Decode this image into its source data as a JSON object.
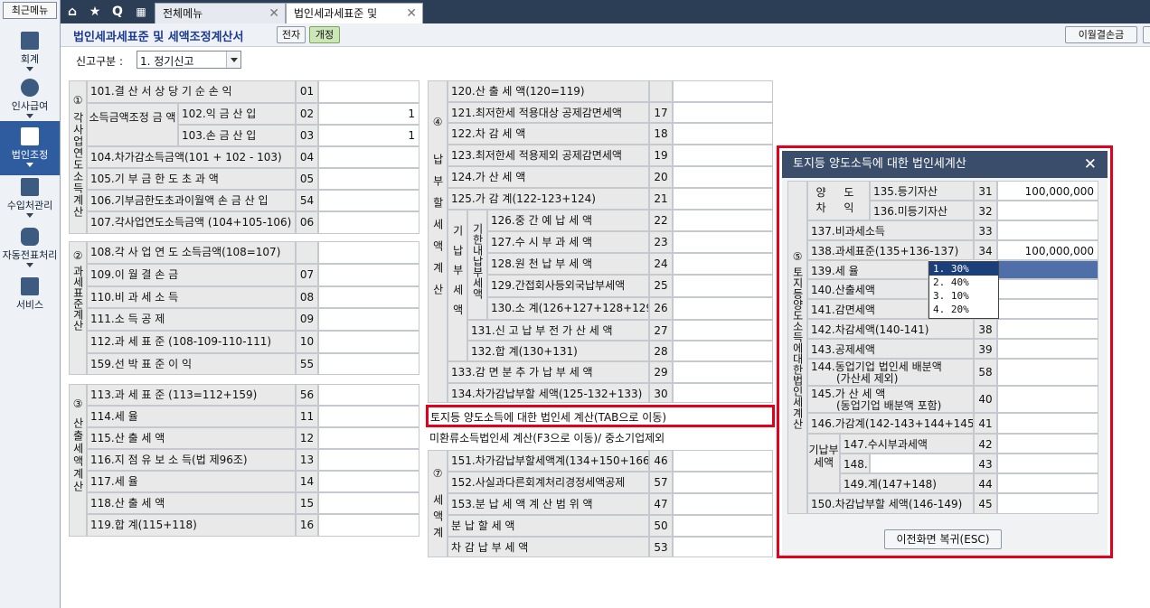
{
  "sidebar": {
    "recent": "최근메뉴",
    "items": [
      {
        "label": "회계",
        "icon": "calculator-icon"
      },
      {
        "label": "인사급여",
        "icon": "person-icon"
      },
      {
        "label": "법인조정",
        "icon": "building-icon"
      },
      {
        "label": "수입처관리",
        "icon": "people-icon"
      },
      {
        "label": "자동전표처리",
        "icon": "database-icon"
      },
      {
        "label": "서비스",
        "icon": "monitor-icon"
      }
    ]
  },
  "topbar": {
    "home": "⌂",
    "star": "★",
    "q": "Q",
    "tabs": [
      {
        "label": "전체메뉴"
      },
      {
        "label": "법인세과세표준 및"
      }
    ]
  },
  "titlebar": {
    "title": "법인세과세표준 및 세액조정계산서",
    "btn1": "전자",
    "btn2": "개정",
    "btn_right": "이월결손금"
  },
  "filter": {
    "label": "신고구분 :",
    "value": "1. 정기신고"
  },
  "s1": {
    "side": "① 각사업연도소득계산",
    "r101": "101.결 산 서 상 당 기 순 손 익",
    "n101": "01",
    "adj": "소득금액조정 금 액",
    "r102": "102.익 금 산 입",
    "n102": "02",
    "v102": "1",
    "r103": "103.손 금 산 입",
    "n103": "03",
    "v103": "1",
    "r104": "104.차가감소득금액(101 + 102 - 103)",
    "n104": "04",
    "r105": "105.기 부 금 한 도 초 과 액",
    "n105": "05",
    "r106": "106.기부금한도초과이월액 손 금 산 입",
    "n106": "54",
    "r107": "107.각사업연도소득금액 (104+105-106)",
    "n107": "06"
  },
  "s2": {
    "side": "② 과세표준계산",
    "r108": "108.각 사 업 연 도 소득금액(108=107)",
    "r109": "109.이 월 결 손 금",
    "n109": "07",
    "r110": "110.비 과 세 소 득",
    "n110": "08",
    "r111": "111.소 득 공 제",
    "n111": "09",
    "r112": "112.과 세 표 준 (108-109-110-111)",
    "n112": "10",
    "r159": "159.선 박 표 준 이 익",
    "n159": "55"
  },
  "s3": {
    "side": "③ 산출세액계산",
    "r113": "113.과 세 표 준 (113=112+159)",
    "n113": "56",
    "r114": "114.세 율",
    "n114": "11",
    "r115": "115.산 출 세 액",
    "n115": "12",
    "r116": "116.지 점 유 보 소 득(법 제96조)",
    "n116": "13",
    "r117": "117.세 율",
    "n117": "14",
    "r118": "118.산 출 세 액",
    "n118": "15",
    "r119": "119.합 계(115+118)",
    "n119": "16"
  },
  "s4": {
    "side": "④ 납부할세액계산",
    "sub1": "기 납 부 세 액",
    "sub2": "기한내납부세액",
    "r120": "120.산 출 세 액(120=119)",
    "r121": "121.최저한세 적용대상 공제감면세액",
    "n121": "17",
    "r122": "122.차 감 세 액",
    "n122": "18",
    "r123": "123.최저한세 적용제외 공제감면세액",
    "n123": "19",
    "r124": "124.가 산 세 액",
    "n124": "20",
    "r125": "125.가 감 계(122-123+124)",
    "n125": "21",
    "r126": "126.중 간 예 납 세 액",
    "n126": "22",
    "r127": "127.수 시 부 과 세 액",
    "n127": "23",
    "r128": "128.원 천 납 부 세 액",
    "n128": "24",
    "r129": "129.간접회사등외국납부세액",
    "n129": "25",
    "r130": "130.소 계(126+127+128+129)",
    "n130": "26",
    "r131": "131.신 고 납 부 전 가 산 세 액",
    "n131": "27",
    "r132": "132.합 계(130+131)",
    "n132": "28",
    "r133": "133.감 면 분 추 가 납 부 세 액",
    "n133": "29",
    "r134": "134.차가감납부할 세액(125-132+133)",
    "n134": "30"
  },
  "links": {
    "land": "토지등 양도소득에 대한 법인세 계산(TAB으로 이동)",
    "mihw": "미환류소득법인세 계산(F3으로 이동)/ 중소기업제외"
  },
  "s7": {
    "side": "⑦ 세액계",
    "r151": "151.차가감납부할세액계(134+150+166)",
    "n151": "46",
    "r152": "152.사실과다른회계처리경정세액공제",
    "n152": "57",
    "r153": "153.분 납 세 액 계 산 범 위 액",
    "n153": "47",
    "rbun": "분 납 할 세 액",
    "nbun": "50",
    "rcha": "차 감 납 부 세 액",
    "ncha": "53"
  },
  "dialog": {
    "title": "토지등 양도소득에 대한 법인세계산",
    "close": "✕",
    "side": "⑤ 토지등양도소득에대한법인세계산",
    "gain": "양 도 차 익",
    "r135": "135.등기자산",
    "n135": "31",
    "v135": "100,000,000",
    "r136": "136.미등기자산",
    "n136": "32",
    "r137": "137.비과세소득",
    "n137": "33",
    "r138": "138.과세표준(135+136-137)",
    "n138": "34",
    "v138": "100,000,000",
    "r139": "139.세 율",
    "r140": "140.산출세액",
    "r141": "141.감면세액",
    "r142": "142.차감세액(140-141)",
    "n142": "38",
    "r143": "143.공제세액",
    "n143": "39",
    "r144a": "144.동업기업 법인세 배분액",
    "r144b": "(가산세 제외)",
    "n144": "58",
    "r145a": "145.가 산 세 액",
    "r145b": "(동업기업 배분액 포함)",
    "n145": "40",
    "r146": "146.가감계(142-143+144+145)",
    "n146": "41",
    "pre": "기납부세액",
    "r147": "147.수시부과세액",
    "n147": "42",
    "r148": "148.",
    "n148": "43",
    "r149": "149.계(147+148)",
    "n149": "44",
    "r150": "150.차감납부할 세액(146-149)",
    "n150": "45",
    "rate_options": [
      "1. 30%",
      "2. 40%",
      "3. 10%",
      "4. 20%"
    ],
    "back": "이전화면 복귀(ESC)"
  }
}
